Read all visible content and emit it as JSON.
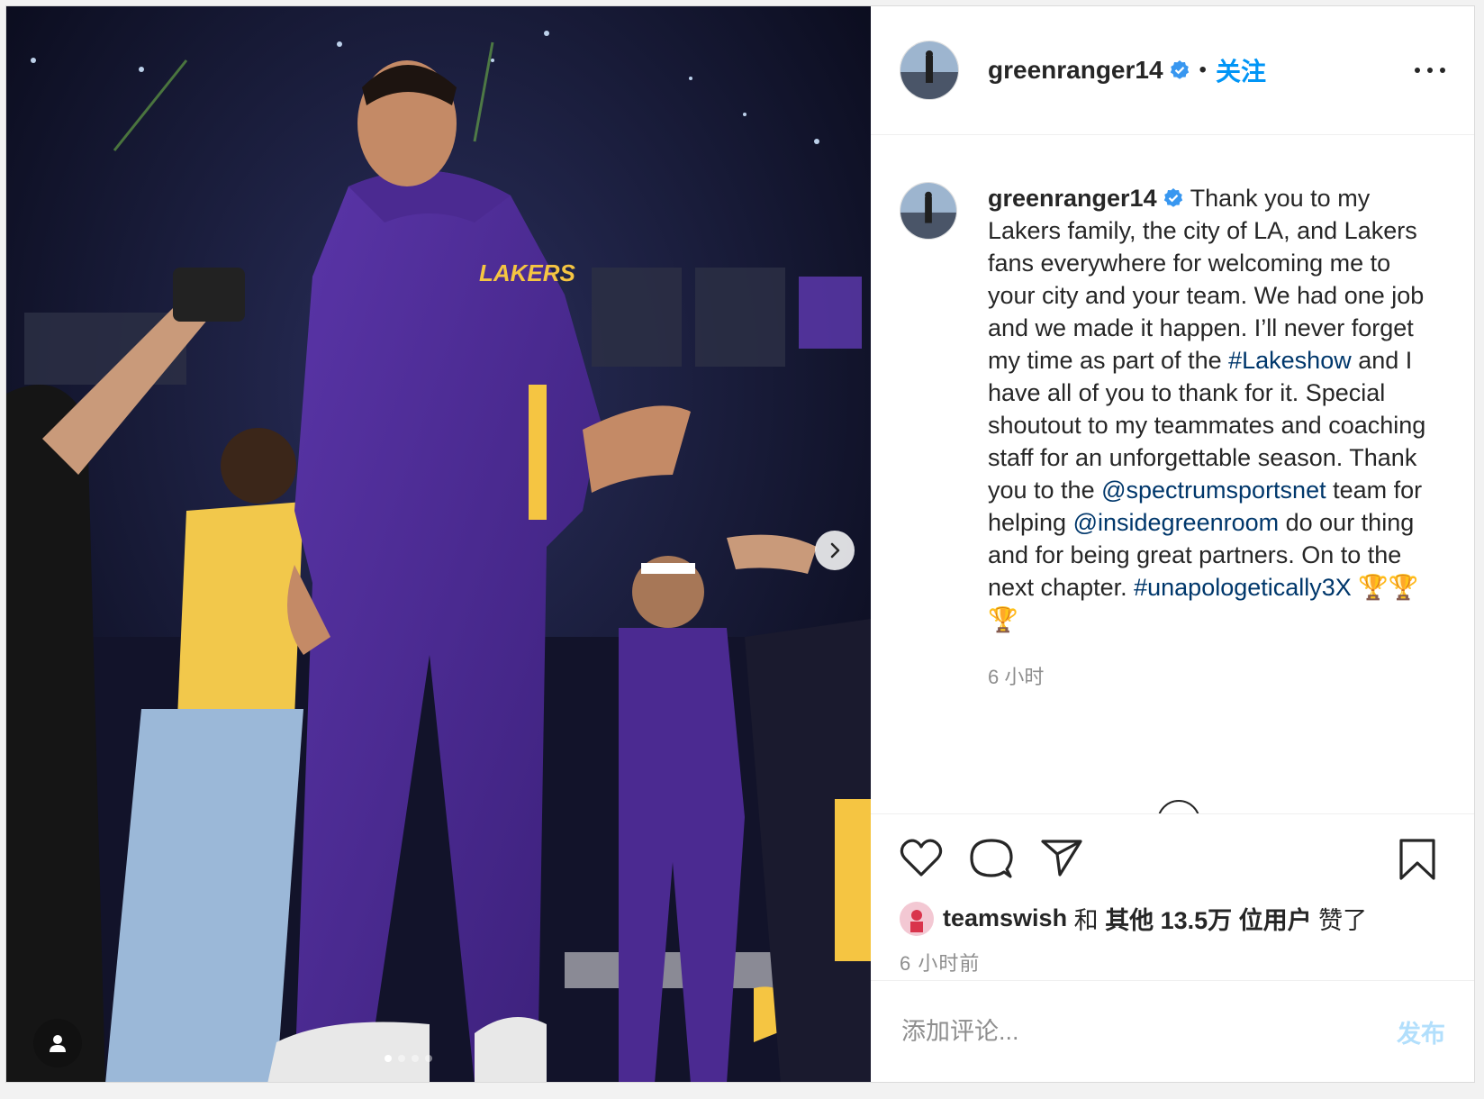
{
  "colors": {
    "link": "#00376b",
    "follow": "#0095f6",
    "verified": "#3897f0",
    "publish_disabled": "#b2dffc",
    "jersey_purple": "#4b2a91",
    "jersey_gold": "#f5c542"
  },
  "header": {
    "username": "greenranger14",
    "separator": "•",
    "follow_label": "关注",
    "verified_icon": "verified-badge-icon",
    "more_icon": "more-options-icon"
  },
  "caption": {
    "username": "greenranger14",
    "segments": [
      {
        "type": "text",
        "text": " Thank you to my Lakers family, the city of LA, and Lakers fans everywhere for welcoming me to your city and your team. We had one job and we made it happen. I’ll never forget my time as part of the "
      },
      {
        "type": "link",
        "text": "#Lakeshow"
      },
      {
        "type": "text",
        "text": " and I have all of you to thank for it. Special shoutout to my teammates and coaching staff for an unforgettable season. Thank you to the "
      },
      {
        "type": "link",
        "text": "@spectrumsportsnet"
      },
      {
        "type": "text",
        "text": " team for helping "
      },
      {
        "type": "link",
        "text": "@insidegreenroom"
      },
      {
        "type": "text",
        "text": " do our thing and for being great partners. On to the next chapter. "
      },
      {
        "type": "link",
        "text": "#unapologetically3X"
      },
      {
        "type": "text",
        "text": " 🏆🏆🏆"
      }
    ],
    "time": "6 小时"
  },
  "actions": {
    "like_icon": "heart-icon",
    "comment_icon": "comment-icon",
    "share_icon": "share-icon",
    "save_icon": "bookmark-icon"
  },
  "likes": {
    "user": "teamswish",
    "joiner": " 和 ",
    "others": "其他 13.5万 位用户",
    "suffix": " 赞了"
  },
  "post_time": "6 小时前",
  "comment": {
    "placeholder": "添加评论...",
    "publish_label": "发布"
  },
  "photo": {
    "carousel_total": 4,
    "carousel_current": 1,
    "next_icon": "chevron-right-icon",
    "tag_icon": "user-tag-icon"
  }
}
